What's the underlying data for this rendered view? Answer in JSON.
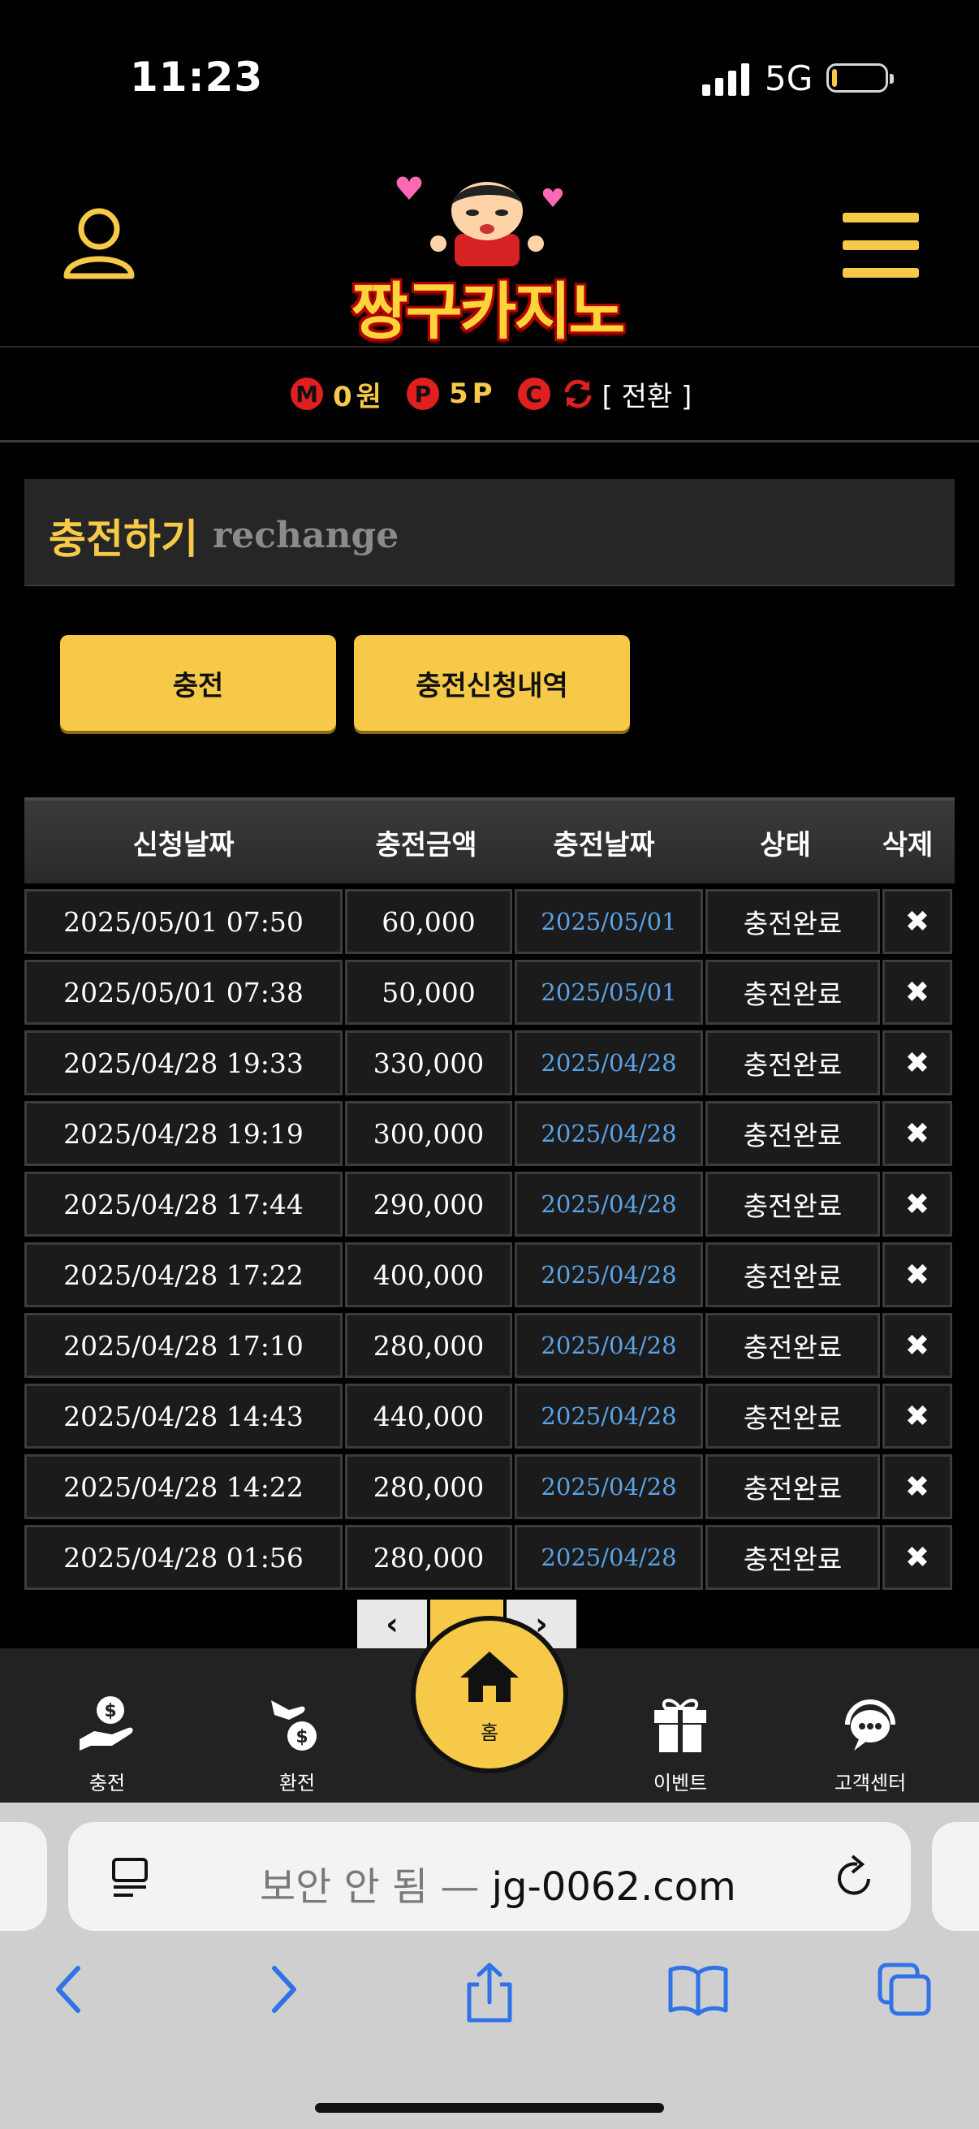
{
  "status_bar": {
    "time": "11:23",
    "network": "5G"
  },
  "header": {
    "logo_text": "짱구카지노"
  },
  "balance": {
    "m_badge": "M",
    "m_value": "0원",
    "p_badge": "P",
    "p_value": "5P",
    "c_badge": "C",
    "switch_label": "[ 전환 ]"
  },
  "section": {
    "title_ko": "충전하기",
    "title_en": "rechange"
  },
  "buttons": {
    "charge": "충전",
    "history": "충전신청내역"
  },
  "table": {
    "headers": [
      "신청날짜",
      "충전금액",
      "충전날짜",
      "상태",
      "삭제"
    ],
    "rows": [
      {
        "req": "2025/05/01 07:50",
        "amount": "60,000",
        "date": "2025/05/01",
        "status": "충전완료"
      },
      {
        "req": "2025/05/01 07:38",
        "amount": "50,000",
        "date": "2025/05/01",
        "status": "충전완료"
      },
      {
        "req": "2025/04/28 19:33",
        "amount": "330,000",
        "date": "2025/04/28",
        "status": "충전완료"
      },
      {
        "req": "2025/04/28 19:19",
        "amount": "300,000",
        "date": "2025/04/28",
        "status": "충전완료"
      },
      {
        "req": "2025/04/28 17:44",
        "amount": "290,000",
        "date": "2025/04/28",
        "status": "충전완료"
      },
      {
        "req": "2025/04/28 17:22",
        "amount": "400,000",
        "date": "2025/04/28",
        "status": "충전완료"
      },
      {
        "req": "2025/04/28 17:10",
        "amount": "280,000",
        "date": "2025/04/28",
        "status": "충전완료"
      },
      {
        "req": "2025/04/28 14:43",
        "amount": "440,000",
        "date": "2025/04/28",
        "status": "충전완료"
      },
      {
        "req": "2025/04/28 14:22",
        "amount": "280,000",
        "date": "2025/04/28",
        "status": "충전완료"
      },
      {
        "req": "2025/04/28 01:56",
        "amount": "280,000",
        "date": "2025/04/28",
        "status": "충전완료"
      }
    ],
    "delete_glyph": "✖"
  },
  "pager": {
    "prev": "‹",
    "next": "›"
  },
  "bottom_nav": {
    "charge": "충전",
    "exchange": "환전",
    "home": "홈",
    "event": "이벤트",
    "support": "고객센터"
  },
  "browser": {
    "security_label": "보안 안 됨 — ",
    "domain": "jg-0062.com"
  },
  "colors": {
    "accent": "#f7c948",
    "badge_red": "#e0201e",
    "link_blue": "#5aa3e8"
  }
}
